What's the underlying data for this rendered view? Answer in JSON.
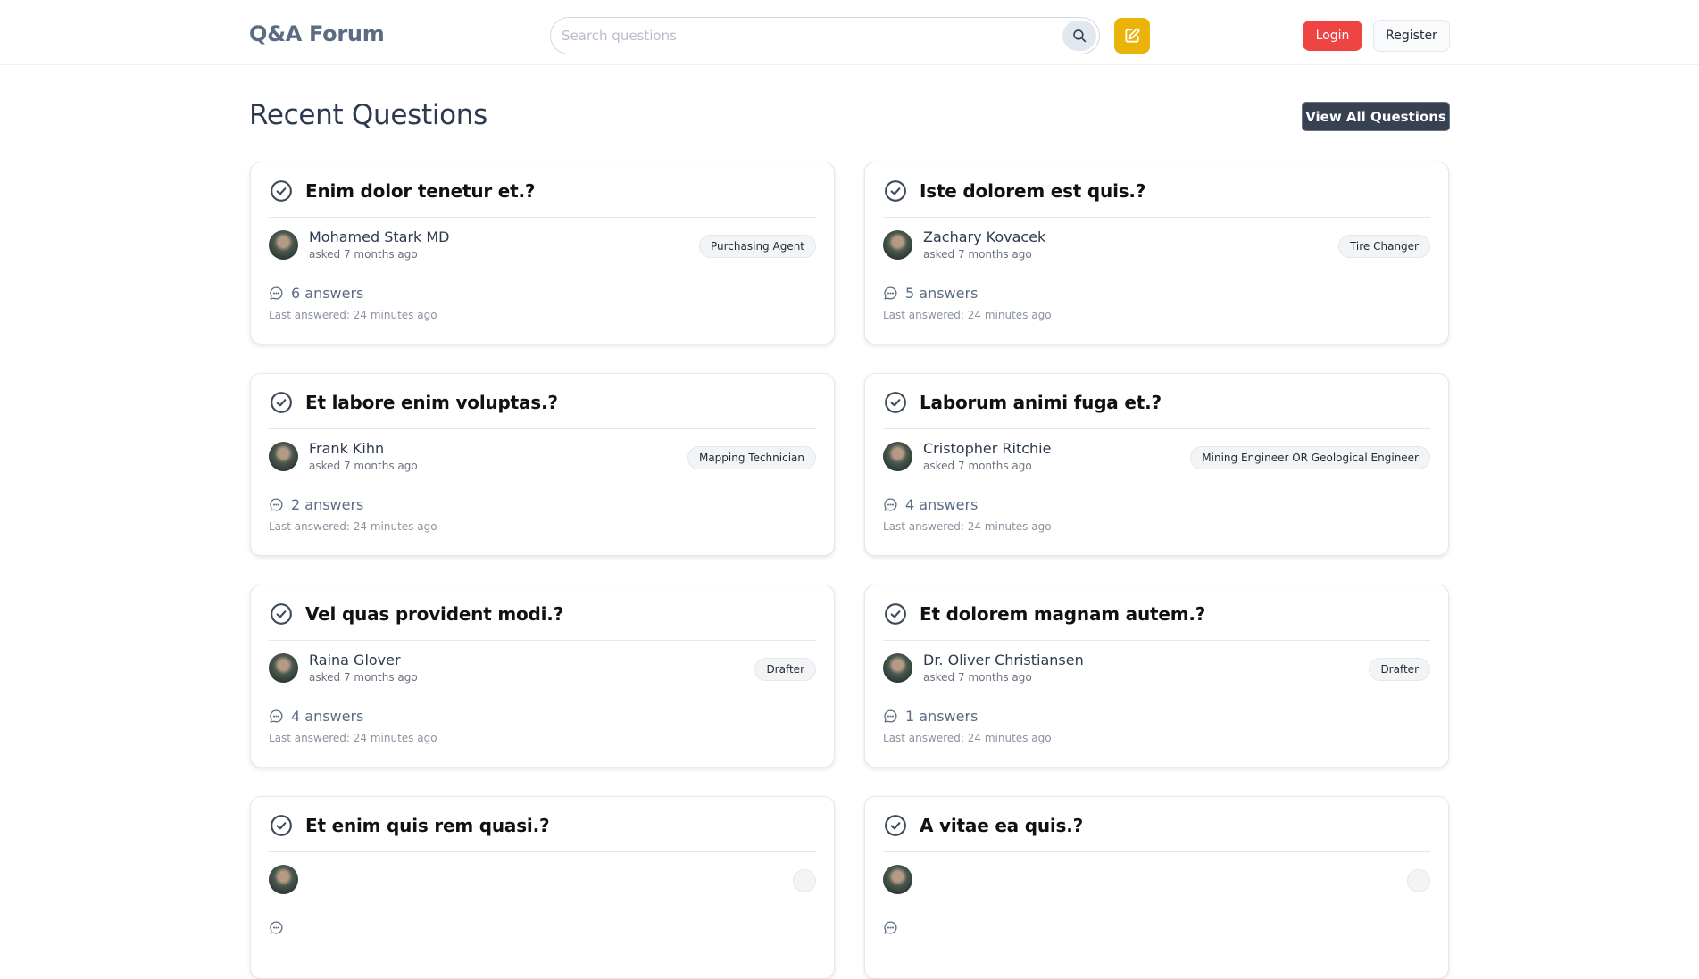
{
  "header": {
    "brand": "Q&A Forum",
    "search_placeholder": "Search questions",
    "search_value": "",
    "search_icon": "search-icon",
    "new_question_icon": "edit-icon",
    "login_label": "Login",
    "register_label": "Register"
  },
  "main": {
    "title": "Recent Questions",
    "view_all_label": "View All Questions"
  },
  "colors": {
    "brand": "#5b6b82",
    "login": "#ef4444",
    "new_question": "#eab308",
    "view_all": "#374151"
  },
  "questions": [
    {
      "title": "Enim dolor tenetur et.?",
      "author": "Mohamed Stark MD",
      "asked": "asked 7 months ago",
      "tag": "Purchasing Agent",
      "answers": "6 answers",
      "last_answered": "Last answered: 24 minutes ago"
    },
    {
      "title": "Iste dolorem est quis.?",
      "author": "Zachary Kovacek",
      "asked": "asked 7 months ago",
      "tag": "Tire Changer",
      "answers": "5 answers",
      "last_answered": "Last answered: 24 minutes ago"
    },
    {
      "title": "Et labore enim voluptas.?",
      "author": "Frank Kihn",
      "asked": "asked 7 months ago",
      "tag": "Mapping Technician",
      "answers": "2 answers",
      "last_answered": "Last answered: 24 minutes ago"
    },
    {
      "title": "Laborum animi fuga et.?",
      "author": "Cristopher Ritchie",
      "asked": "asked 7 months ago",
      "tag": "Mining Engineer OR Geological Engineer",
      "answers": "4 answers",
      "last_answered": "Last answered: 24 minutes ago"
    },
    {
      "title": "Vel quas provident modi.?",
      "author": "Raina Glover",
      "asked": "asked 7 months ago",
      "tag": "Drafter",
      "answers": "4 answers",
      "last_answered": "Last answered: 24 minutes ago"
    },
    {
      "title": "Et dolorem magnam autem.?",
      "author": "Dr. Oliver Christiansen",
      "asked": "asked 7 months ago",
      "tag": "Drafter",
      "answers": "1 answers",
      "last_answered": "Last answered: 24 minutes ago"
    },
    {
      "title": "Et enim quis rem quasi.?"
    },
    {
      "title": "A vitae ea quis.?"
    }
  ]
}
